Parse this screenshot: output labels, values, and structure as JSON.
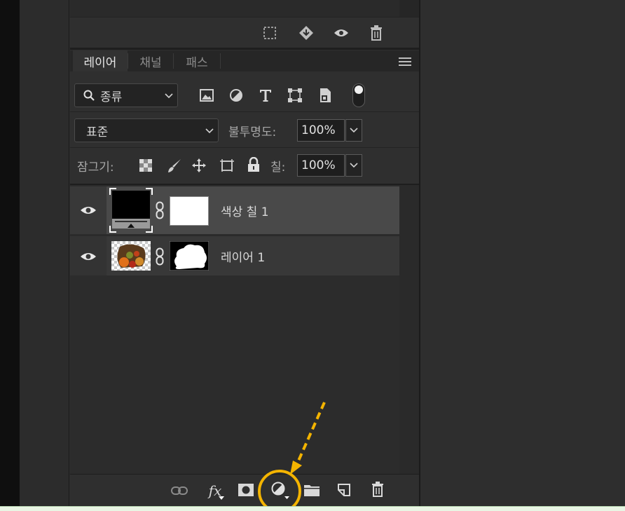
{
  "top_toolbar": {
    "icons": [
      "selection-icon",
      "diamond-arrow-icon",
      "eye-icon",
      "trash-icon"
    ]
  },
  "tabs": [
    {
      "label": "레이어",
      "active": true
    },
    {
      "label": "채널",
      "active": false
    },
    {
      "label": "패스",
      "active": false
    }
  ],
  "filter": {
    "kind_label": "종류",
    "icons": [
      "image-filter-icon",
      "adjustment-filter-icon",
      "type-filter-icon",
      "shape-filter-icon",
      "smart-object-filter-icon",
      "filter-toggle-icon"
    ]
  },
  "blend": {
    "mode": "표준",
    "opacity_label": "불투명도:",
    "opacity_value": "100%"
  },
  "lock": {
    "label": "잠그기:",
    "fill_label": "칠:",
    "fill_value": "100%",
    "icons": [
      "lock-transparent-icon",
      "lock-paint-icon",
      "lock-move-icon",
      "lock-artboard-icon",
      "lock-all-icon"
    ]
  },
  "layers": [
    {
      "name": "색상 칠 1",
      "visible": true,
      "selected": true
    },
    {
      "name": "레이어 1",
      "visible": true,
      "selected": false
    }
  ],
  "bottom_toolbar": {
    "fx_label": "fx",
    "icons": [
      "link-icon",
      "fx-icon",
      "mask-icon",
      "adjustment-layer-icon",
      "folder-icon",
      "new-layer-icon",
      "trash-icon"
    ]
  },
  "colors": {
    "highlight": "#f4b400",
    "selected_row": "#494949",
    "panel_bg": "#2f2f2f"
  }
}
